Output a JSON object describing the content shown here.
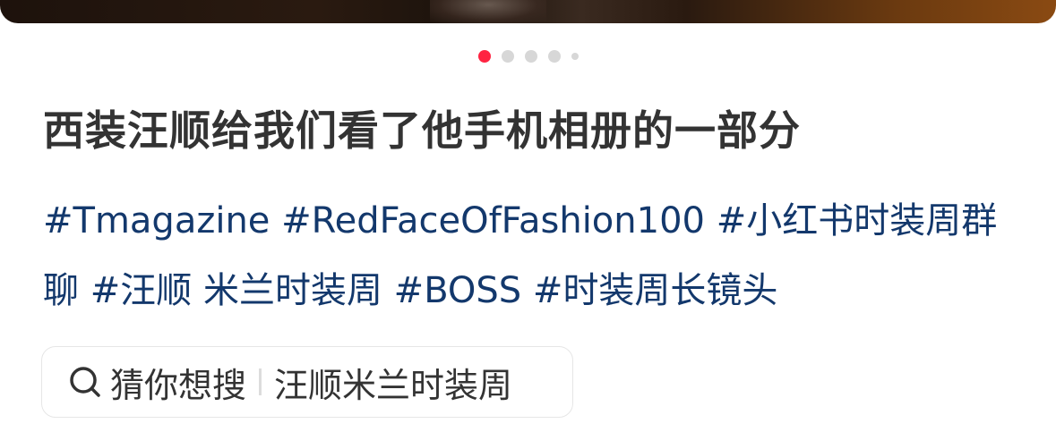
{
  "hero": {
    "image_name": "post-image"
  },
  "carousel": {
    "total_visible_dots": 5,
    "active_index": 0,
    "active_color": "#ff2442",
    "inactive_color": "#d7d7d7"
  },
  "post": {
    "title": "西装汪顺给我们看了他手机相册的一部分",
    "tags": [
      "#Tmagazine",
      "#RedFaceOfFashion100",
      "#小红书时装周群聊",
      "#汪顺 米兰时装周",
      "#BOSS",
      "#时装周长镜头"
    ],
    "tag_color": "#13386c"
  },
  "search_suggestion": {
    "icon": "search-icon",
    "label": "猜你想搜",
    "keyword": "汪顺米兰时装周"
  }
}
